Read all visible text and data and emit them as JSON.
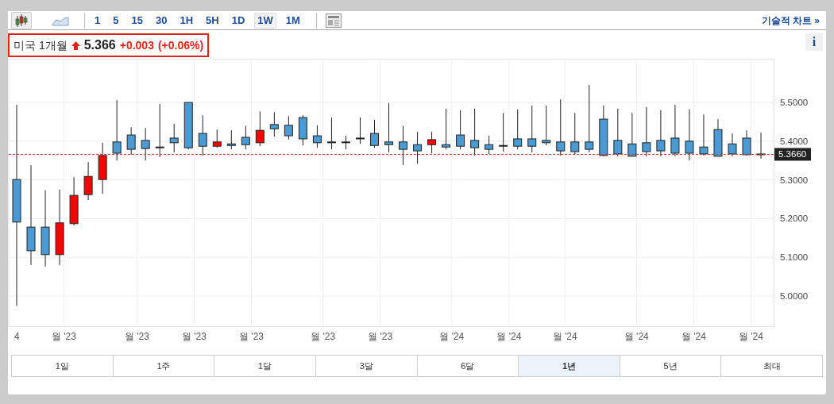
{
  "toolbar": {
    "chart_types": [
      {
        "kind": "candles",
        "selected": true
      },
      {
        "kind": "line",
        "selected": false
      }
    ],
    "intervals": [
      {
        "label": "1",
        "selected": false
      },
      {
        "label": "5",
        "selected": false
      },
      {
        "label": "15",
        "selected": false
      },
      {
        "label": "30",
        "selected": false
      },
      {
        "label": "1H",
        "selected": false
      },
      {
        "label": "5H",
        "selected": false
      },
      {
        "label": "1D",
        "selected": false
      },
      {
        "label": "1W",
        "selected": true
      },
      {
        "label": "1M",
        "selected": false
      }
    ],
    "link": {
      "label": "기술적 차트",
      "arrow": "»"
    }
  },
  "quote": {
    "name": "미국 1개월",
    "up": true,
    "price": "5.366",
    "change": "+0.003",
    "change_pct": "(+0.06%)"
  },
  "info_button": {
    "label": "i"
  },
  "chart": {
    "x_labels": [
      "4",
      "월 '23",
      "월 '23",
      "월 '23",
      "월 '23",
      "월 '23",
      "월 '23",
      "월 '24",
      "월 '24",
      "월 '24",
      "월 '24",
      "월 '24",
      "월 '24"
    ],
    "chart_data": {
      "type": "candlestick",
      "grid": true,
      "ref_lines": [
        {
          "axis": "y",
          "value": 5.366,
          "label": "5.3660"
        }
      ],
      "ylim": [
        4.922,
        5.613
      ],
      "yticks": [
        {
          "value": 5.5,
          "label": "5.5000"
        },
        {
          "value": 5.4,
          "label": "5.4000"
        },
        {
          "value": 5.3,
          "label": "5.3000"
        },
        {
          "value": 5.2,
          "label": "5.2000"
        },
        {
          "value": 5.1,
          "label": "5.1000"
        },
        {
          "value": 5.0,
          "label": "5.0000"
        }
      ],
      "ohlc": [
        [
          5.301,
          5.494,
          4.975,
          5.191
        ],
        [
          5.178,
          5.338,
          5.08,
          5.117
        ],
        [
          5.178,
          5.273,
          5.076,
          5.107
        ],
        [
          5.107,
          5.275,
          5.08,
          5.189
        ],
        [
          5.187,
          5.307,
          5.182,
          5.26
        ],
        [
          5.262,
          5.346,
          5.248,
          5.309
        ],
        [
          5.301,
          5.396,
          5.264,
          5.363
        ],
        [
          5.398,
          5.506,
          5.35,
          5.369
        ],
        [
          5.416,
          5.436,
          5.365,
          5.379
        ],
        [
          5.402,
          5.434,
          5.35,
          5.381
        ],
        [
          5.385,
          5.496,
          5.359,
          5.383
        ],
        [
          5.408,
          5.445,
          5.371,
          5.396
        ],
        [
          5.5,
          5.5,
          5.379,
          5.383
        ],
        [
          5.42,
          5.467,
          5.363,
          5.387
        ],
        [
          5.387,
          5.43,
          5.383,
          5.398
        ],
        [
          5.393,
          5.428,
          5.379,
          5.389
        ],
        [
          5.41,
          5.439,
          5.379,
          5.391
        ],
        [
          5.396,
          5.477,
          5.387,
          5.428
        ],
        [
          5.443,
          5.475,
          5.412,
          5.432
        ],
        [
          5.441,
          5.465,
          5.404,
          5.414
        ],
        [
          5.461,
          5.467,
          5.389,
          5.406
        ],
        [
          5.414,
          5.441,
          5.383,
          5.396
        ],
        [
          5.398,
          5.461,
          5.379,
          5.396
        ],
        [
          5.398,
          5.414,
          5.379,
          5.396
        ],
        [
          5.408,
          5.461,
          5.393,
          5.406
        ],
        [
          5.42,
          5.455,
          5.383,
          5.389
        ],
        [
          5.398,
          5.498,
          5.371,
          5.391
        ],
        [
          5.398,
          5.439,
          5.338,
          5.379
        ],
        [
          5.391,
          5.424,
          5.342,
          5.375
        ],
        [
          5.391,
          5.424,
          5.369,
          5.404
        ],
        [
          5.391,
          5.484,
          5.379,
          5.385
        ],
        [
          5.416,
          5.48,
          5.379,
          5.387
        ],
        [
          5.402,
          5.484,
          5.363,
          5.383
        ],
        [
          5.391,
          5.414,
          5.367,
          5.379
        ],
        [
          5.389,
          5.473,
          5.373,
          5.387
        ],
        [
          5.406,
          5.482,
          5.379,
          5.387
        ],
        [
          5.406,
          5.492,
          5.371,
          5.387
        ],
        [
          5.402,
          5.492,
          5.389,
          5.396
        ],
        [
          5.398,
          5.508,
          5.363,
          5.375
        ],
        [
          5.398,
          5.473,
          5.365,
          5.373
        ],
        [
          5.398,
          5.545,
          5.371,
          5.379
        ],
        [
          5.457,
          5.492,
          5.361,
          5.363
        ],
        [
          5.402,
          5.484,
          5.361,
          5.367
        ],
        [
          5.393,
          5.473,
          5.361,
          5.361
        ],
        [
          5.396,
          5.488,
          5.361,
          5.373
        ],
        [
          5.402,
          5.48,
          5.361,
          5.375
        ],
        [
          5.408,
          5.494,
          5.361,
          5.369
        ],
        [
          5.4,
          5.482,
          5.35,
          5.369
        ],
        [
          5.385,
          5.469,
          5.363,
          5.367
        ],
        [
          5.43,
          5.457,
          5.361,
          5.361
        ],
        [
          5.393,
          5.42,
          5.361,
          5.367
        ],
        [
          5.408,
          5.428,
          5.363,
          5.365
        ],
        [
          5.367,
          5.422,
          5.355,
          5.366
        ]
      ]
    }
  },
  "periods": [
    {
      "label": "1일",
      "selected": false
    },
    {
      "label": "1주",
      "selected": false
    },
    {
      "label": "1달",
      "selected": false
    },
    {
      "label": "3달",
      "selected": false
    },
    {
      "label": "6달",
      "selected": false
    },
    {
      "label": "1년",
      "selected": true
    },
    {
      "label": "5년",
      "selected": false
    },
    {
      "label": "최대",
      "selected": false
    }
  ]
}
